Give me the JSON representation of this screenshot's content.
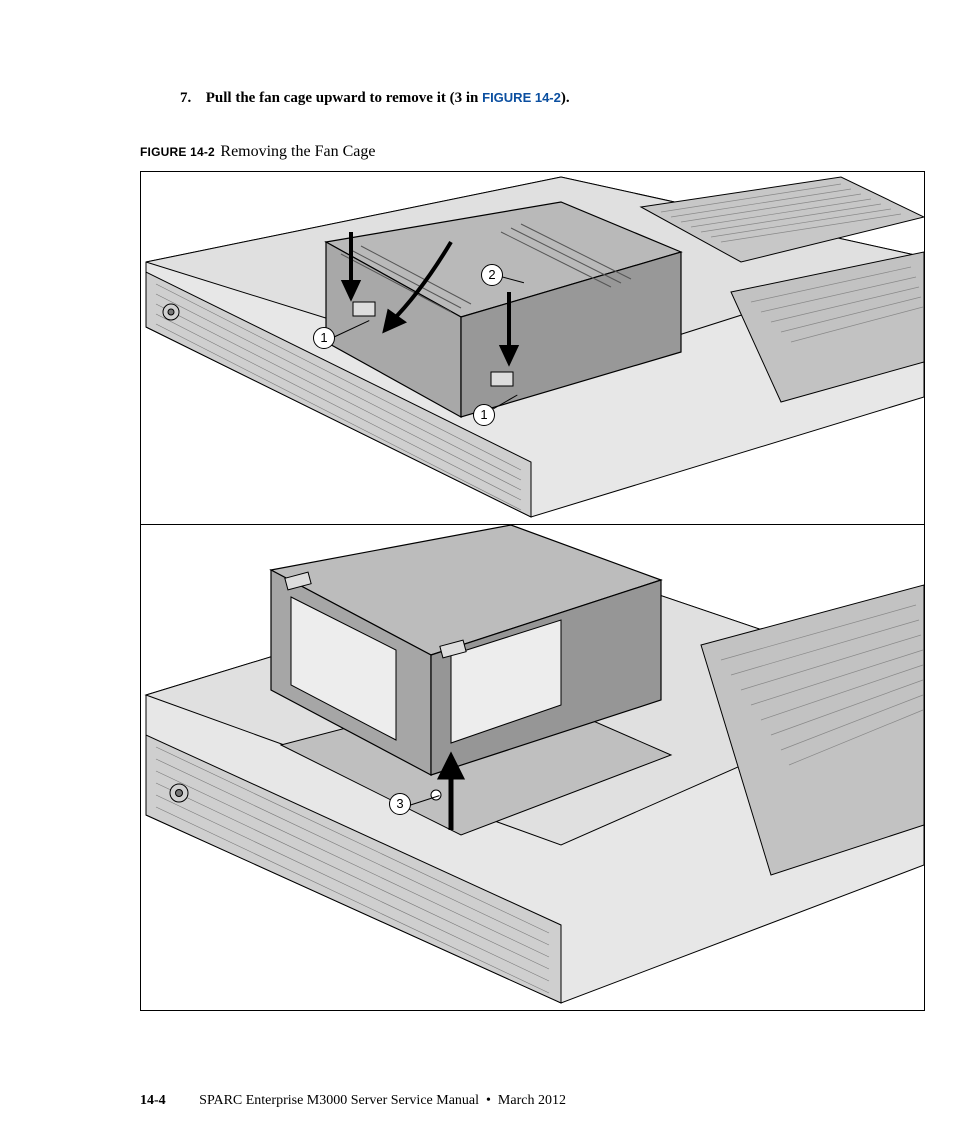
{
  "step": {
    "number": "7.",
    "text_prefix": "Pull the fan cage upward to remove it (3 in ",
    "figure_ref": "FIGURE 14-2",
    "text_suffix": ")."
  },
  "figure": {
    "code": "FIGURE 14-2",
    "title": "Removing the Fan Cage",
    "callouts_top": [
      "1",
      "2",
      "1"
    ],
    "callouts_bottom": [
      "3"
    ]
  },
  "footer": {
    "page": "14-4",
    "doc_title": "SPARC Enterprise M3000 Server Service Manual",
    "separator": "•",
    "date": "March 2012"
  }
}
